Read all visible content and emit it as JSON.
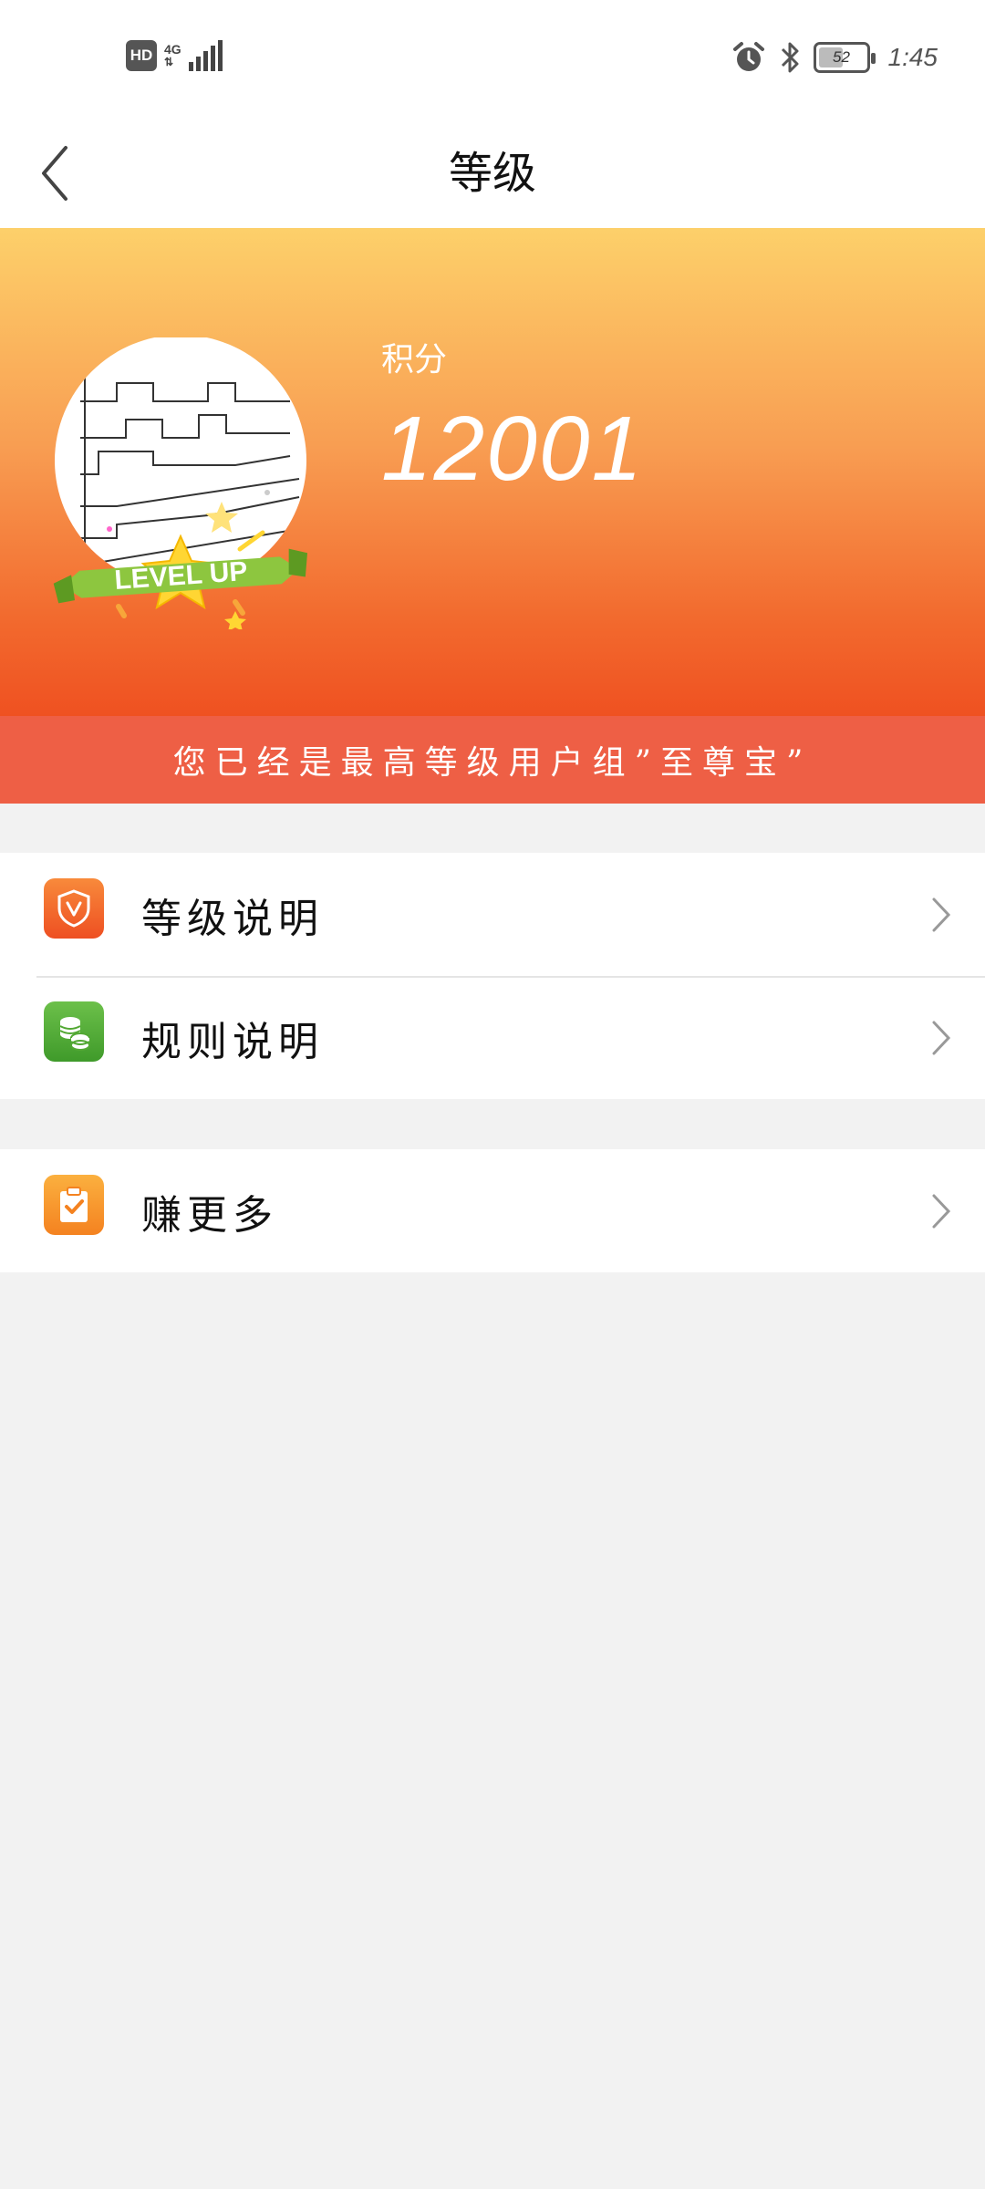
{
  "status_bar": {
    "hd": "HD",
    "network": "4G",
    "battery_level": "52",
    "time": "1:45",
    "icons": [
      "hd-icon",
      "signal-icon",
      "alarm-icon",
      "bluetooth-icon",
      "battery-icon"
    ]
  },
  "header": {
    "title": "等级",
    "back_icon": "chevron-left-icon"
  },
  "profile": {
    "badge_text": "LEVEL UP",
    "points_label": "积分",
    "points_value": "12001"
  },
  "level_notice": "您已经是最高等级用户组”至尊宝”",
  "menu": {
    "group1": [
      {
        "label": "等级说明",
        "icon": "shield-v-icon",
        "color": "#f06a2b"
      },
      {
        "label": "规则说明",
        "icon": "coins-icon",
        "color": "#52a833"
      }
    ],
    "group2": [
      {
        "label": "赚更多",
        "icon": "clipboard-check-icon",
        "color": "#f7952b"
      }
    ]
  },
  "colors": {
    "hero_top": "#fdd06a",
    "hero_bottom": "#ef5121",
    "banner": "#ee5f45",
    "background": "#f2f2f2"
  }
}
